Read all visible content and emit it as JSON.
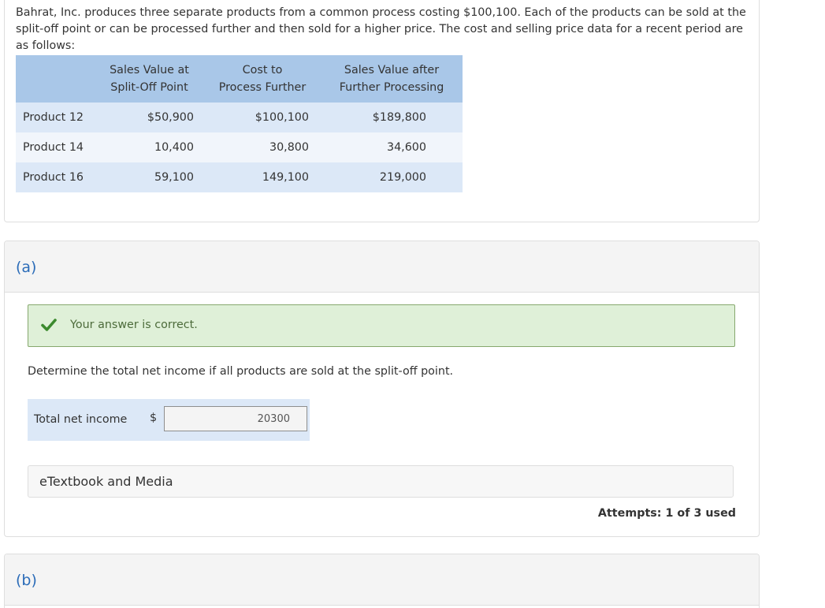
{
  "problem": {
    "text": "Bahrat, Inc. produces three separate products from a common process costing $100,100. Each of the products can be sold at the split-off point or can be processed further and then sold for a higher price. The cost and selling price data for a recent period are as follows:"
  },
  "table": {
    "headers": [
      [
        "Sales Value at",
        "Split-Off Point"
      ],
      [
        "Cost to",
        "Process Further"
      ],
      [
        "Sales Value after",
        "Further Processing"
      ]
    ],
    "rows": [
      {
        "product": "Product 12",
        "split_off": "$50,900",
        "cost": "$100,100",
        "after": "$189,800"
      },
      {
        "product": "Product 14",
        "split_off": "10,400",
        "cost": "30,800",
        "after": "34,600"
      },
      {
        "product": "Product 16",
        "split_off": "59,100",
        "cost": "149,100",
        "after": "219,000"
      }
    ]
  },
  "part_a": {
    "label": "(a)",
    "feedback": "Your answer is correct.",
    "question": "Determine the total net income if all products are sold at the split-off point.",
    "answer_label": "Total net income",
    "currency": "$",
    "answer_value": "20300",
    "etextbook_label": "eTextbook and Media",
    "attempts": "Attempts: 1 of 3 used"
  },
  "part_b": {
    "label": "(b)"
  },
  "colors": {
    "header_blue": "#a9c7e8",
    "row_blue": "#dce8f7",
    "part_label_blue": "#2b6cb8",
    "success_green": "#3c8a2e",
    "success_bg": "#dff0d8"
  }
}
